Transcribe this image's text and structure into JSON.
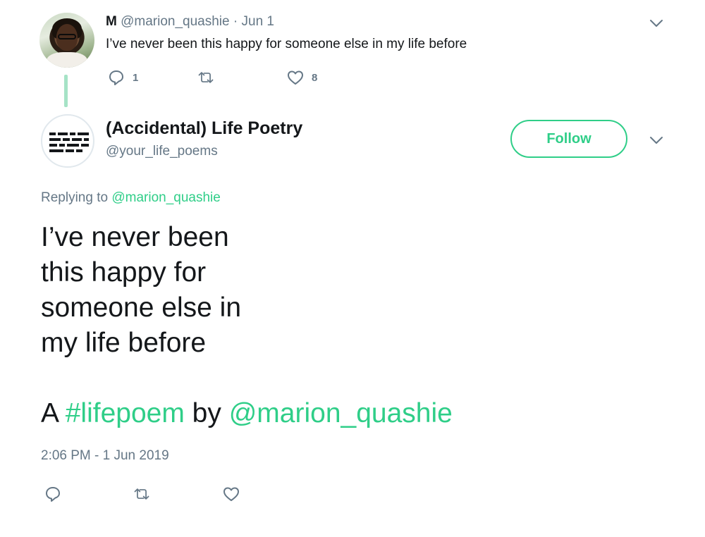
{
  "parent_tweet": {
    "name": "M",
    "handle": "@marion_quashie",
    "separator": "·",
    "date": "Jun 1",
    "text": "I’ve never been this happy for someone else in my life before",
    "actions": {
      "reply_icon": "reply-icon",
      "reply_count": "1",
      "retweet_icon": "retweet-icon",
      "like_icon": "heart-icon",
      "like_count": "8"
    },
    "menu_icon": "chevron-down-icon"
  },
  "main_tweet": {
    "name": "(Accidental) Life Poetry",
    "handle": "@your_life_poems",
    "follow_label": "Follow",
    "menu_icon": "chevron-down-icon",
    "replying_prefix": "Replying to",
    "replying_to": "@marion_quashie",
    "poem_lines": [
      "I’ve never been",
      "this happy for",
      "someone else in",
      "my life before"
    ],
    "credit": {
      "prefix": "A",
      "hashtag": "#lifepoem",
      "middle": "by",
      "mention": "@marion_quashie"
    },
    "timestamp": "2:06 PM - 1 Jun 2019",
    "actions": {
      "reply_icon": "reply-icon",
      "retweet_icon": "retweet-icon",
      "like_icon": "heart-icon"
    }
  },
  "colors": {
    "accent": "#2fce88",
    "muted": "#657786",
    "text": "#14171a",
    "thread_line": "#a6e3c6"
  }
}
